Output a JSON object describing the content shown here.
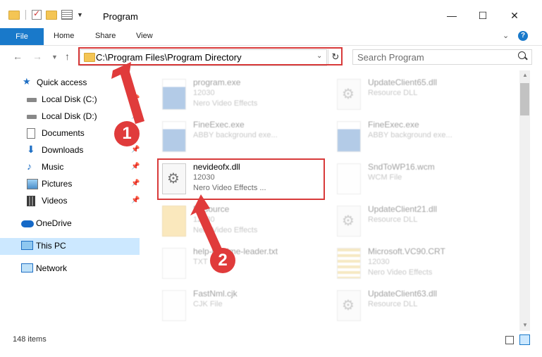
{
  "window": {
    "title": "Program"
  },
  "ribbon": {
    "file": "File",
    "home": "Home",
    "share": "Share",
    "view": "View"
  },
  "address": {
    "path": "C:\\Program Files\\Program Directory"
  },
  "search": {
    "placeholder": "Search Program"
  },
  "sidebar": {
    "items": [
      {
        "label": "Quick access"
      },
      {
        "label": "Local Disk (C:)"
      },
      {
        "label": "Local Disk (D:)"
      },
      {
        "label": "Documents"
      },
      {
        "label": "Downloads"
      },
      {
        "label": "Music"
      },
      {
        "label": "Pictures"
      },
      {
        "label": "Videos"
      },
      {
        "label": "OneDrive"
      },
      {
        "label": "This PC"
      },
      {
        "label": "Network"
      }
    ]
  },
  "files": [
    {
      "name": "program.exe",
      "line1": "12030",
      "line2": "Nero Video Effects"
    },
    {
      "name": "UpdateClient65.dll",
      "line1": "Resource DLL",
      "line2": ""
    },
    {
      "name": "FineExec.exe",
      "line1": "ABBY background exe...",
      "line2": ""
    },
    {
      "name": "FineExec.exe",
      "line1": "ABBY background exe...",
      "line2": ""
    },
    {
      "name": "nevideofx.dll",
      "line1": "12030",
      "line2": "Nero Video Effects ..."
    },
    {
      "name": "SndToWP16.wcm",
      "line1": "WCM File",
      "line2": ""
    },
    {
      "name": "Resource",
      "line1": "12030",
      "line2": "Nero Video Effects"
    },
    {
      "name": "UpdateClient21.dll",
      "line1": "Resource DLL",
      "line2": ""
    },
    {
      "name": "help-readme-leader.txt",
      "line1": "TXT File",
      "line2": ""
    },
    {
      "name": "Microsoft.VC90.CRT",
      "line1": "12030",
      "line2": "Nero Video Effects"
    },
    {
      "name": "FastNml.cjk",
      "line1": "CJK File",
      "line2": ""
    },
    {
      "name": "UpdateClient63.dll",
      "line1": "Resource DLL",
      "line2": ""
    }
  ],
  "status": {
    "count": "148 items"
  },
  "annotations": {
    "step1": "1",
    "step2": "2"
  },
  "colors": {
    "accent": "#1979ca",
    "highlight": "#d83a3a",
    "selection": "#cce8ff"
  }
}
